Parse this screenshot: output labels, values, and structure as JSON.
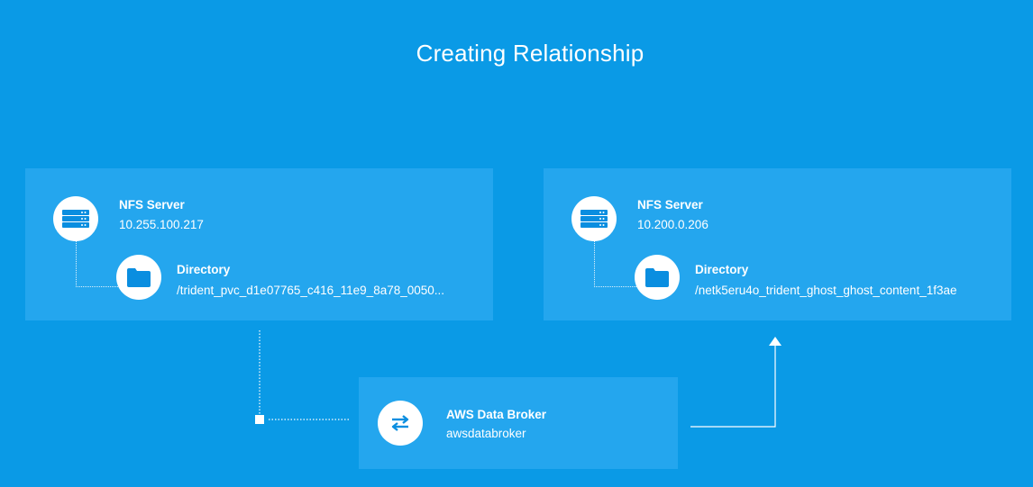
{
  "page": {
    "title": "Creating Relationship"
  },
  "source": {
    "server_label": "NFS Server",
    "server_address": "10.255.100.217",
    "directory_label": "Directory",
    "directory_path": "/trident_pvc_d1e07765_c416_11e9_8a78_0050..."
  },
  "target": {
    "server_label": "NFS Server",
    "server_address": "10.200.0.206",
    "directory_label": "Directory",
    "directory_path": "/netk5eru4o_trident_ghost_ghost_content_1f3ae"
  },
  "broker": {
    "label": "AWS Data Broker",
    "name": "awsdatabroker",
    "icon": "swap-arrows-icon"
  },
  "colors": {
    "background": "#0a9ae6",
    "panel": "#24a6ee",
    "icon": "#0a8ee0"
  }
}
